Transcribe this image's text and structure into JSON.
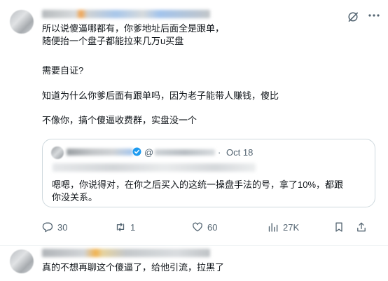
{
  "post": {
    "text_lines": [
      "所以说傻逼哪都有，你爹地址后面全是跟单，",
      "随便抬一个盘子都能拉来几万u买盘",
      "需要自证?",
      "知道为什么你爹后面有跟单吗，因为老子能带人赚钱，傻比",
      "不像你，搞个傻逼收费群，实盘没一个"
    ],
    "quote": {
      "at_symbol": "@",
      "separator": "·",
      "date": "Oct 18",
      "text_lines": [
        "嗯嗯，你说得对，在你之后买入的这统一操盘手法的号，拿了10%，都跟",
        "你没关系。"
      ]
    },
    "actions": {
      "replies": "30",
      "retweets": "1",
      "likes": "60",
      "views": "27K"
    },
    "icons": [
      "grok-icon",
      "more-icon",
      "verified-icon",
      "reply-icon",
      "retweet-icon",
      "like-icon",
      "views-icon",
      "bookmark-icon",
      "share-icon"
    ]
  },
  "reply": {
    "text": "真的不想再聊这个傻逼了，给他引流，拉黑了"
  },
  "colors": {
    "text": "#0f1419",
    "muted": "#536471",
    "border": "#cfd9de",
    "verified": "#1d9bf0"
  }
}
